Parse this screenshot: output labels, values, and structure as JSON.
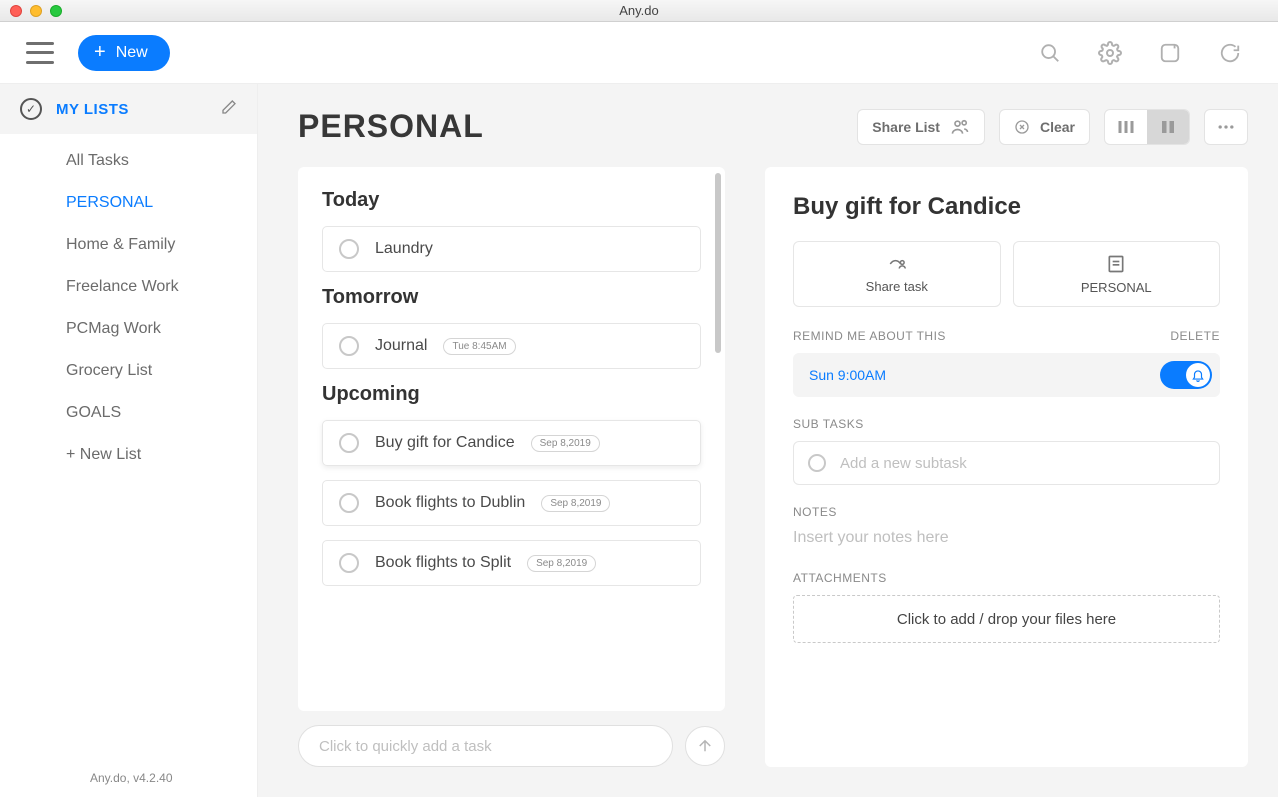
{
  "window": {
    "title": "Any.do"
  },
  "toolbar": {
    "new_label": "New"
  },
  "sidebar": {
    "header": "MY LISTS",
    "items": [
      {
        "label": "All Tasks"
      },
      {
        "label": "PERSONAL"
      },
      {
        "label": "Home & Family"
      },
      {
        "label": "Freelance Work"
      },
      {
        "label": "PCMag Work"
      },
      {
        "label": "Grocery List"
      },
      {
        "label": "GOALS"
      },
      {
        "label": "+ New List"
      }
    ],
    "footer": "Any.do, v4.2.40"
  },
  "page": {
    "title": "PERSONAL",
    "share_label": "Share List",
    "clear_label": "Clear"
  },
  "sections": {
    "today": {
      "title": "Today",
      "tasks": [
        {
          "title": "Laundry"
        }
      ]
    },
    "tomorrow": {
      "title": "Tomorrow",
      "tasks": [
        {
          "title": "Journal",
          "badge": "Tue 8:45AM"
        }
      ]
    },
    "upcoming": {
      "title": "Upcoming",
      "tasks": [
        {
          "title": "Buy gift for Candice",
          "badge": "Sep 8,2019"
        },
        {
          "title": "Book flights to Dublin",
          "badge": "Sep 8,2019"
        },
        {
          "title": "Book flights to Split",
          "badge": "Sep 8,2019"
        }
      ]
    }
  },
  "quick_add": {
    "placeholder": "Click to quickly add a task"
  },
  "detail": {
    "title": "Buy gift for Candice",
    "share_task": "Share task",
    "list_name": "PERSONAL",
    "remind_label": "REMIND ME ABOUT THIS",
    "delete_label": "DELETE",
    "reminder_time": "Sun 9:00AM",
    "subtasks_label": "SUB TASKS",
    "subtask_placeholder": "Add a new subtask",
    "notes_label": "NOTES",
    "notes_placeholder": "Insert your notes here",
    "attachments_label": "ATTACHMENTS",
    "dropzone": "Click to add / drop your files here"
  }
}
